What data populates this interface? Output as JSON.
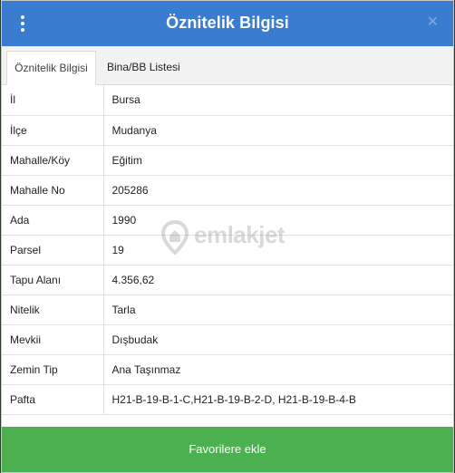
{
  "header": {
    "title": "Öznitelik Bilgisi",
    "close_glyph": "✕",
    "menu_icon": "vertical-dots-icon"
  },
  "tabs": [
    {
      "label": "Öznitelik Bilgisi",
      "active": true
    },
    {
      "label": "Bina/BB Listesi",
      "active": false
    }
  ],
  "rows": [
    {
      "key": "İl",
      "value": "Bursa"
    },
    {
      "key": "İlçe",
      "value": "Mudanya"
    },
    {
      "key": "Mahalle/Köy",
      "value": "Eğitim"
    },
    {
      "key": "Mahalle No",
      "value": "205286"
    },
    {
      "key": "Ada",
      "value": "1990"
    },
    {
      "key": "Parsel",
      "value": "19"
    },
    {
      "key": "Tapu Alanı",
      "value": "4.356,62"
    },
    {
      "key": "Nitelik",
      "value": "Tarla"
    },
    {
      "key": "Mevkii",
      "value": "Dışbudak"
    },
    {
      "key": "Zemin Tip",
      "value": "Ana Taşınmaz"
    },
    {
      "key": "Pafta",
      "value": "H21-B-19-B-1-C,H21-B-19-B-2-D, H21-B-19-B-4-B"
    }
  ],
  "watermark": {
    "text": "emlakjet",
    "icon": "location-pin-icon"
  },
  "footer": {
    "button_label": "Favorilere ekle"
  },
  "colors": {
    "header": "#3a7dd0",
    "footer": "#4caf50"
  }
}
